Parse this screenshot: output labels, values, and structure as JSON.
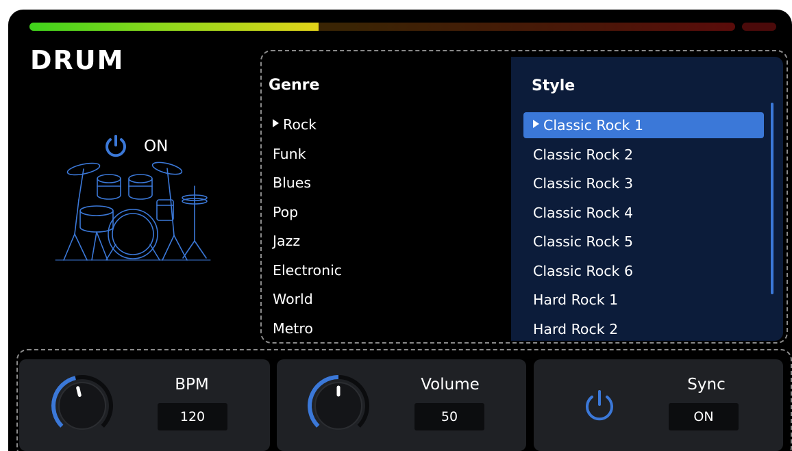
{
  "colors": {
    "accent": "#3b78d8",
    "meter_green": "#3fd31c",
    "meter_yellow": "#e3d419",
    "panel_bg": "#0c1c3a"
  },
  "level_meter": {
    "fill_fraction": 0.41
  },
  "title": "DRUM",
  "power": {
    "icon": "power-icon",
    "state_label": "ON"
  },
  "genre": {
    "heading": "Genre",
    "selected_index": 0,
    "items": [
      "Rock",
      "Funk",
      "Blues",
      "Pop",
      "Jazz",
      "Electronic",
      "World",
      "Metro"
    ]
  },
  "style": {
    "heading": "Style",
    "selected_index": 0,
    "items": [
      "Classic Rock 1",
      "Classic Rock 2",
      "Classic Rock 3",
      "Classic Rock 4",
      "Classic Rock 5",
      "Classic Rock 6",
      "Hard Rock 1",
      "Hard Rock 2"
    ]
  },
  "bpm": {
    "label": "BPM",
    "value": "120",
    "knob_fraction": 0.45
  },
  "volume": {
    "label": "Volume",
    "value": "50",
    "knob_fraction": 0.5
  },
  "sync": {
    "label": "Sync",
    "value": "ON",
    "icon": "power-icon"
  }
}
